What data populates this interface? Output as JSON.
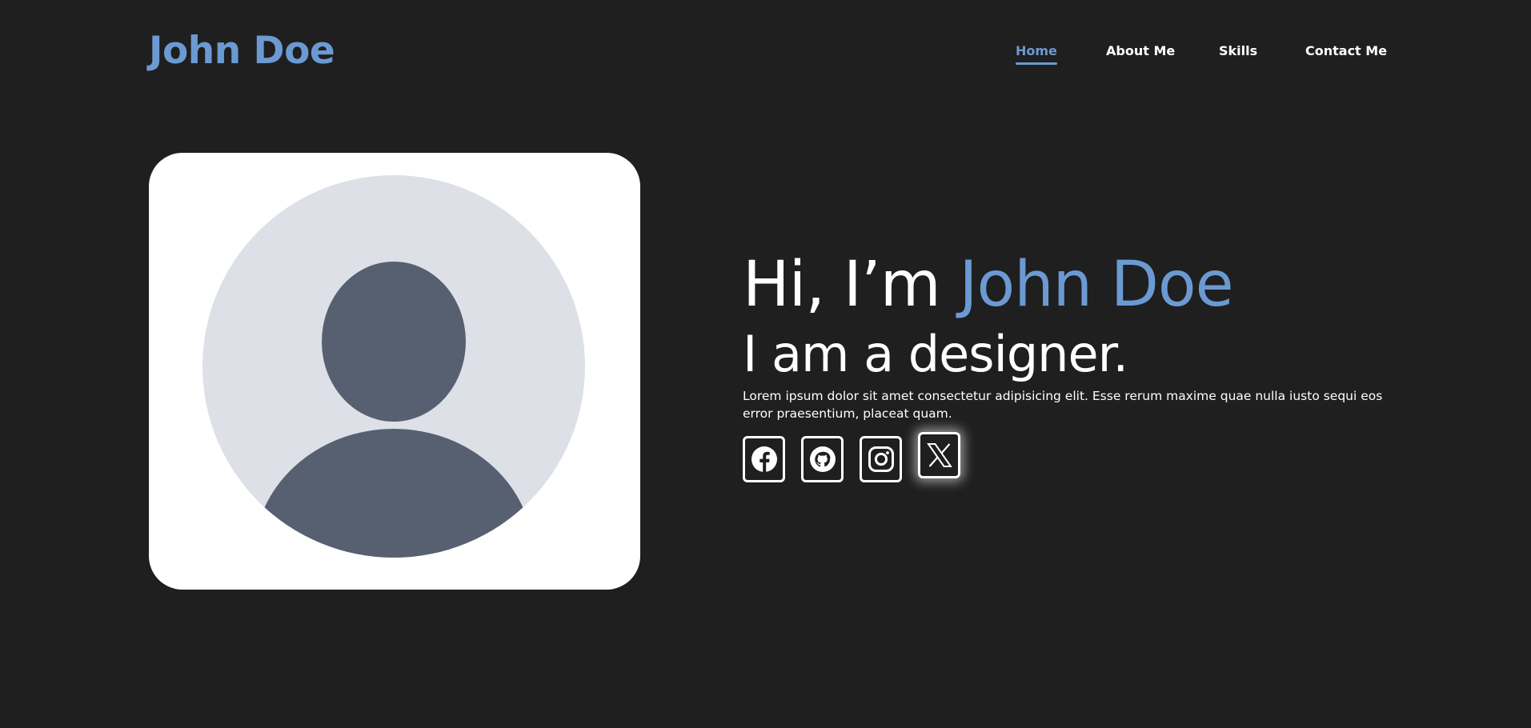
{
  "header": {
    "logo": "John Doe",
    "nav": [
      {
        "label": "Home",
        "active": true
      },
      {
        "label": "About Me",
        "active": false
      },
      {
        "label": "Skills",
        "active": false
      },
      {
        "label": "Contact Me",
        "active": false
      }
    ]
  },
  "hero": {
    "greeting": "Hi, I’m ",
    "name": "John Doe",
    "role": "I am a designer.",
    "description": "Lorem ipsum dolor sit amet consectetur adipisicing elit. Esse rerum maxime quae nulla iusto sequi eos error praesentium, placeat quam.",
    "avatar_icon": "user-avatar-icon"
  },
  "socials": [
    {
      "icon": "facebook-icon"
    },
    {
      "icon": "github-icon"
    },
    {
      "icon": "instagram-icon"
    },
    {
      "icon": "x-twitter-icon"
    }
  ],
  "colors": {
    "background": "#1f1f1f",
    "accent": "#6b9ad3",
    "text": "#ffffff",
    "card": "#ffffff",
    "avatar_bg": "#dde0e6",
    "avatar_fg": "#566070"
  }
}
